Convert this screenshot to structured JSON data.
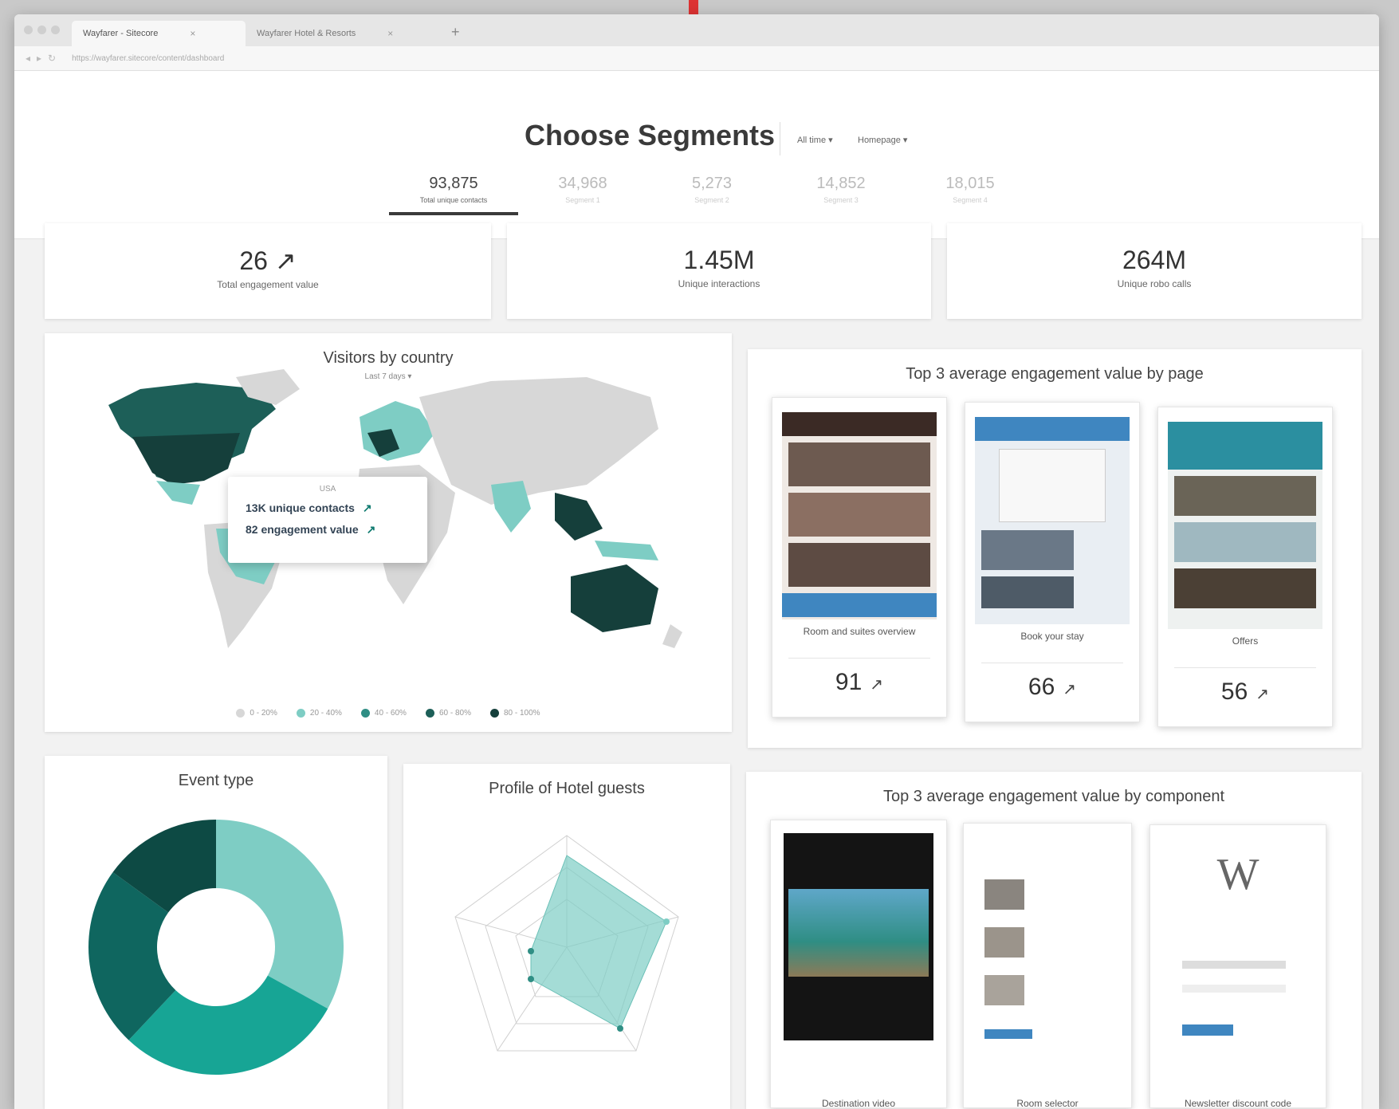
{
  "browser": {
    "tabs": [
      {
        "label": "Wayfarer - Sitecore",
        "close": "×"
      },
      {
        "label": "Wayfarer Hotel & Resorts",
        "close": "×"
      }
    ],
    "new_tab": "+",
    "url": "https://wayfarer.sitecore/content/dashboard"
  },
  "header": {
    "title": "Choose Segments",
    "time_filter": "All time ▾",
    "page_filter": "Homepage ▾"
  },
  "segments": [
    {
      "value": "93,875",
      "label": "Total unique contacts"
    },
    {
      "value": "34,968",
      "label": "Segment 1"
    },
    {
      "value": "5,273",
      "label": "Segment 2"
    },
    {
      "value": "14,852",
      "label": "Segment 3"
    },
    {
      "value": "18,015",
      "label": "Segment 4"
    }
  ],
  "kpis": [
    {
      "value": "26 ↗",
      "label": "Total engagement value"
    },
    {
      "value": "1.45M",
      "label": "Unique interactions"
    },
    {
      "value": "264M",
      "label": "Unique robo calls"
    }
  ],
  "map_card": {
    "title": "Visitors by country",
    "subtitle": "Last 7 days ▾",
    "tooltip": {
      "country": "USA",
      "line1": "13K unique contacts",
      "line2": "82 engagement value",
      "arrow": "↗"
    },
    "legend": [
      {
        "label": "0 - 20%",
        "color": "#d7d7d7"
      },
      {
        "label": "20 - 40%",
        "color": "#7ecdc4"
      },
      {
        "label": "40 - 60%",
        "color": "#2f8e84"
      },
      {
        "label": "60 - 80%",
        "color": "#1d5f58"
      },
      {
        "label": "80 - 100%",
        "color": "#153f3b"
      }
    ]
  },
  "pages_card": {
    "title": "Top 3 average engagement value by page",
    "items": [
      {
        "caption": "Room and suites overview",
        "score": "91",
        "arrow": "↗"
      },
      {
        "caption": "Book your stay",
        "score": "66",
        "arrow": "↗"
      },
      {
        "caption": "Offers",
        "score": "56",
        "arrow": "↗"
      }
    ]
  },
  "event_card": {
    "title": "Event type",
    "chart_data": {
      "type": "pie",
      "values": [
        33,
        29,
        23,
        15
      ],
      "colors": [
        "#7ecdc4",
        "#17a595",
        "#0f665f",
        "#0d4a44"
      ]
    }
  },
  "profile_card": {
    "title": "Profile of Hotel guests"
  },
  "components_card": {
    "title": "Top 3 average engagement value by component",
    "items": [
      {
        "caption": "Destination video"
      },
      {
        "caption": "Room selector"
      },
      {
        "caption": "Newsletter discount code"
      }
    ],
    "logo_letter": "W"
  }
}
